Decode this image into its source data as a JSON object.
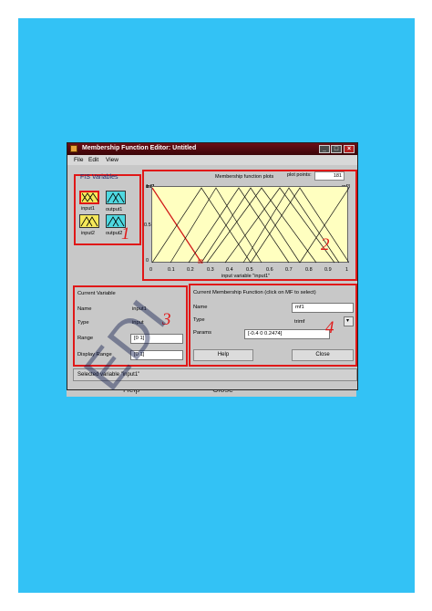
{
  "window": {
    "title": "Membership Function Editor: Untitled",
    "menu": [
      "File",
      "Edit",
      "View"
    ]
  },
  "fis_variables": {
    "title": "FIS Variables",
    "items": [
      {
        "label": "input1",
        "selected": true
      },
      {
        "label": "output1",
        "selected": false
      },
      {
        "label": "input2",
        "selected": false
      },
      {
        "label": "output2",
        "selected": false
      }
    ]
  },
  "plot": {
    "title": "Membership function plots",
    "plot_points_label": "plot points:",
    "plot_points": "181",
    "mf_labels": [
      "mf1",
      "mf5",
      "mf2",
      "mf3"
    ],
    "y_ticks": [
      "1",
      "0.5",
      "0"
    ],
    "x_ticks": [
      "0",
      "0.1",
      "0.2",
      "0.3",
      "0.4",
      "0.5",
      "0.6",
      "0.7",
      "0.8",
      "0.9",
      "1"
    ],
    "xlabel": "input variable \"input1\""
  },
  "current_variable": {
    "title": "Current Variable",
    "name_label": "Name",
    "name_value": "input1",
    "type_label": "Type",
    "type_value": "input",
    "range_label": "Range",
    "range_value": "[0 1]",
    "display_range_label": "Display Range",
    "display_range_value": "[0 1]"
  },
  "current_mf": {
    "title": "Current Membership Function (click on MF to select)",
    "name_label": "Name",
    "name_value": "mf1",
    "type_label": "Type",
    "type_value": "trimf",
    "params_label": "Params",
    "params_value": "[-0.4 0 0.2474]",
    "help_button": "Help",
    "close_button": "Close"
  },
  "status": "Selected variable \"input1\"",
  "annotations": [
    "1",
    "2",
    "3",
    "4"
  ],
  "watermark": "EDI",
  "ghost_bar": {
    "help": "Help",
    "close": "Close"
  },
  "colors": {
    "page_bg": "#33c2f5",
    "highlight": "#e01818",
    "plot_bg": "#ffffc0",
    "titlebar": "#6b0e16"
  }
}
